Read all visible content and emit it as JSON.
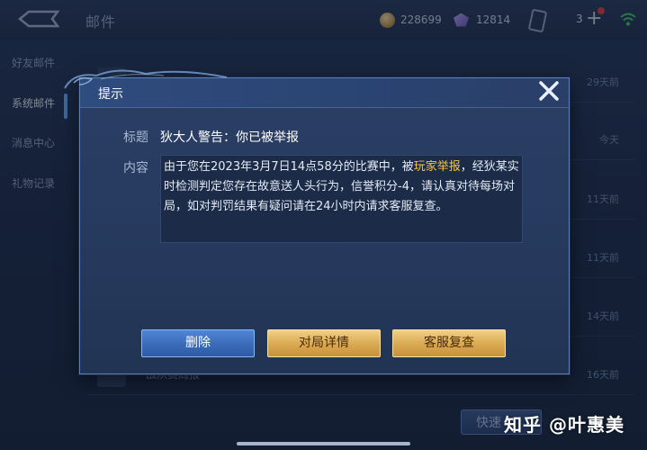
{
  "header": {
    "title": "邮件",
    "coins": "228699",
    "gems": "12814",
    "plus_count": "3"
  },
  "sidebar": {
    "items": [
      {
        "label": "好友邮件"
      },
      {
        "label": "系统邮件"
      },
      {
        "label": "消息中心"
      },
      {
        "label": "礼物记录"
      }
    ]
  },
  "mail_list": {
    "rows": [
      {
        "date": "29天前"
      },
      {
        "date": "今天"
      },
      {
        "date": "11天前"
      },
      {
        "date": "11天前"
      },
      {
        "date": "14天前"
      },
      {
        "date": "16天前",
        "name": "战队赛周报"
      }
    ],
    "quick_button": "快速"
  },
  "dialog": {
    "title": "提示",
    "subject_label": "标题",
    "subject": "狄大人警告：你已被举报",
    "content_label": "内容",
    "content_part1": "由于您在2023年3月7日14点58分的比赛中，被",
    "content_highlight": "玩家举报",
    "content_part2": "，经狄某实时检测判定您存在故意送人头行为，信誉积分-4，请认真对待每场对局，如对判罚结果有疑问请在24小时内请求客服复查。",
    "buttons": {
      "delete": "删除",
      "match_detail": "对局详情",
      "customer_service": "客服复查"
    }
  },
  "watermark": "知乎 @叶惠美",
  "colors": {
    "highlight": "#f6c646",
    "accent_blue": "#4f86d6",
    "accent_gold": "#d9a850"
  }
}
